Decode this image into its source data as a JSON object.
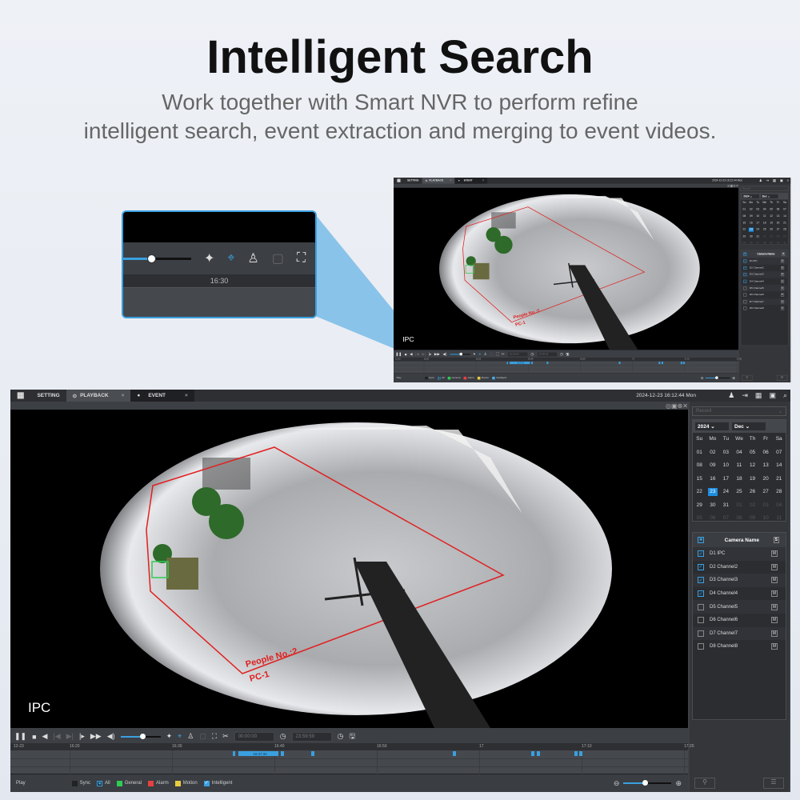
{
  "hero": {
    "title": "Intelligent Search",
    "subtitle_line1": "Work together with Smart NVR to perform refine",
    "subtitle_line2": "intelligent search, event extraction and merging to event videos."
  },
  "titlebar": {
    "grid_icon": "grid-icon",
    "tabs": [
      {
        "label": "SETTING"
      },
      {
        "label": "PLAYBACK"
      },
      {
        "label": "EVENT"
      }
    ],
    "datetime": "2024-12-23 16:12:44 Mon",
    "icons": [
      "user-icon",
      "logout-icon",
      "layout-icon",
      "monitor-icon",
      "search-icon"
    ]
  },
  "video": {
    "camera_label": "IPC",
    "overlay_line1": "People No.:2",
    "overlay_line2": "PC-1",
    "tools": "◎▣⊕✕"
  },
  "sidebar": {
    "record_select": "Record",
    "year": "2024",
    "month": "Dec",
    "weekdays": [
      "Su",
      "Mo",
      "Tu",
      "We",
      "Th",
      "Fr",
      "Sa"
    ],
    "days": [
      "01",
      "02",
      "03",
      "04",
      "05",
      "06",
      "07",
      "08",
      "09",
      "10",
      "11",
      "12",
      "13",
      "14",
      "15",
      "16",
      "17",
      "18",
      "19",
      "20",
      "21",
      "22",
      "23",
      "24",
      "25",
      "26",
      "27",
      "28",
      "29",
      "30",
      "31",
      "01",
      "02",
      "03",
      "04",
      "05",
      "06",
      "07",
      "08",
      "09",
      "10",
      "11"
    ],
    "selected_day": "23",
    "camera_header": "Camera Name",
    "header_btn": "S",
    "cameras": [
      {
        "name": "D1 IPC",
        "checked": true
      },
      {
        "name": "D2 Channel2",
        "checked": true
      },
      {
        "name": "D3 Channel3",
        "checked": true
      },
      {
        "name": "D4 Channel4",
        "checked": true
      },
      {
        "name": "D5 Channel5",
        "checked": false
      },
      {
        "name": "D6 Channel6",
        "checked": false
      },
      {
        "name": "D7 Channel7",
        "checked": false
      },
      {
        "name": "D8 Channel8",
        "checked": false
      }
    ],
    "m_label": "M"
  },
  "controls": {
    "start_time": "00:00:00",
    "end_time": "23:59:59",
    "volume": 0.55,
    "zoom": 0.45
  },
  "timeline": {
    "date": "12-23",
    "ticks": [
      "16:20",
      "16:30",
      "16:40",
      "16:50",
      "17",
      "17:10",
      "17:20"
    ],
    "segment_label": "16:37:32",
    "events_minutes_after_1620": [
      [
        15.9,
        16.2
      ],
      [
        16.5,
        20.4
      ],
      [
        20.6,
        20.9
      ],
      [
        23.6,
        23.9
      ],
      [
        37.4,
        37.7
      ],
      [
        45.1,
        45.4
      ],
      [
        45.6,
        45.9
      ],
      [
        49.3,
        49.6
      ],
      [
        49.8,
        50.1
      ]
    ]
  },
  "legend": {
    "play": "Play",
    "items": [
      {
        "label": "Sync",
        "color": "#222222"
      },
      {
        "label": "All",
        "color": "#3aa0e0"
      },
      {
        "label": "General",
        "color": "#2ecc55"
      },
      {
        "label": "Alarm",
        "color": "#e84040"
      },
      {
        "label": "Motion",
        "color": "#e8cc40"
      },
      {
        "label": "Intelligent",
        "color": "#3aa0e0"
      }
    ]
  },
  "callout": {
    "time": "16:30"
  },
  "colors": {
    "accent": "#3aa0e0",
    "overlay_red": "#e02020"
  }
}
